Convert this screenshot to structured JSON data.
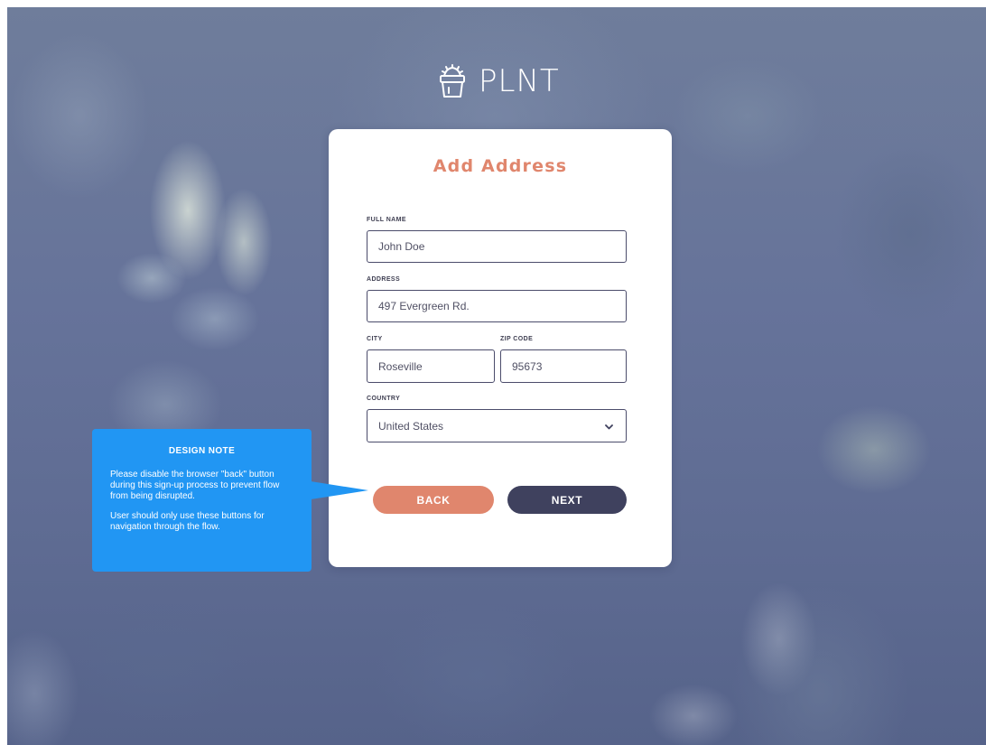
{
  "brand": {
    "name": "PLNT",
    "logo_icon": "plant-pot-icon"
  },
  "form": {
    "title": "Add Address",
    "fields": {
      "full_name": {
        "label": "FULL NAME",
        "value": "John Doe"
      },
      "address": {
        "label": "ADDRESS",
        "value": "497 Evergreen Rd."
      },
      "city": {
        "label": "CITY",
        "value": "Roseville"
      },
      "zip": {
        "label": "ZIP CODE",
        "value": "95673"
      },
      "country": {
        "label": "COUNTRY",
        "value": "United States",
        "icon": "chevron-down-icon"
      }
    },
    "buttons": {
      "back": "BACK",
      "next": "NEXT"
    }
  },
  "design_note": {
    "title": "DESIGN NOTE",
    "paragraphs": [
      "Please disable the browser \"back\" button during this sign-up process to prevent flow from being disrupted.",
      "User should only use these buttons for navigation through the flow."
    ]
  },
  "colors": {
    "accent": "#e0866d",
    "primary_dark": "#3f415e",
    "note_blue": "#2196f3",
    "field_border": "#4b4c6b"
  }
}
